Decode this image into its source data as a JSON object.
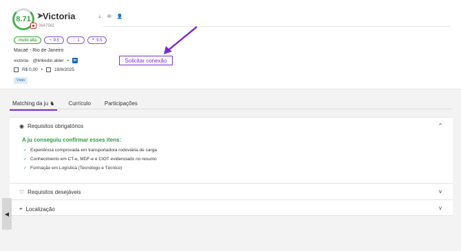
{
  "candidate": {
    "score": "8.71",
    "name": "Victoria",
    "id_fragment": "0647561",
    "city": "Macaé - Rio de Janeiro",
    "email_start": "victoria-",
    "email_end": "@linkedin.abler",
    "contact_separator": "•",
    "salary": "R$ 0,00",
    "meta_separator": "•",
    "date": "19/8/2025",
    "status": "Visto"
  },
  "badges": [
    {
      "label": "muito alta",
      "type": "green"
    },
    {
      "label": "9.5",
      "icon": "gauge-icon"
    },
    {
      "label": "1",
      "icon": "heart-icon"
    },
    {
      "label": "9.5",
      "icon": "pin-icon"
    }
  ],
  "actions": {
    "solicitar_conexao": "Solicitar conexão"
  },
  "tabs": [
    {
      "label": "Matching da ju"
    },
    {
      "label": "Currículo"
    },
    {
      "label": "Participações"
    }
  ],
  "sections": {
    "obrigatorios": "Requisitos obrigatórios",
    "confirm_title": "A ju conseguiu confirmar esses itens:",
    "items": [
      "Experiência comprovada em transportadora rodoviária de carga",
      "Conhecimento em CT-e, MDF-e e CIOT evidenciado no resumo",
      "Formação em Logística (Tecnólogo e Técnico)"
    ],
    "desejaveis": "Requisitos desejáveis",
    "localizacao": "Localização"
  },
  "icons": {
    "chevron_up": "^",
    "chevron_down": "v",
    "left_toggle": "◀"
  },
  "colors": {
    "accent": "#7b2bd3",
    "green": "#3aa541"
  }
}
